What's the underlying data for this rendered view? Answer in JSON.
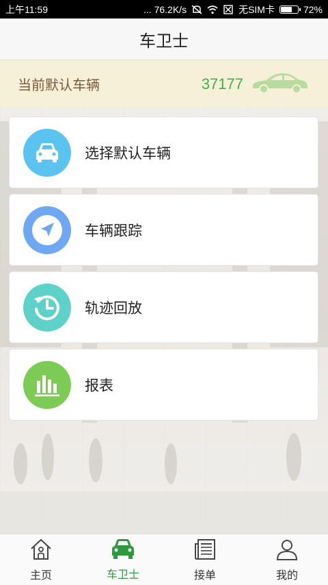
{
  "status_bar": {
    "time": "上午11:59",
    "network_speed": "... 76.2K/s",
    "sim": "无SIM卡",
    "battery": "72%",
    "battery_level": 0.72
  },
  "header": {
    "title": "车卫士"
  },
  "default_vehicle": {
    "label": "当前默认车辆",
    "plate": "37177",
    "car_color": "#b8dca0"
  },
  "menu": [
    {
      "label": "选择默认车辆",
      "icon": "car-icon",
      "color": "#5bc3ef"
    },
    {
      "label": "车辆跟踪",
      "icon": "navigation-arrow-icon",
      "color": "#6ea8f2"
    },
    {
      "label": "轨迹回放",
      "icon": "history-clock-icon",
      "color": "#5ed2c9"
    },
    {
      "label": "报表",
      "icon": "bar-chart-icon",
      "color": "#7ccb55"
    }
  ],
  "bottom_nav": {
    "active_color": "#2e9a3d",
    "items": [
      {
        "label": "主页",
        "icon": "home-icon",
        "active": false
      },
      {
        "label": "车卫士",
        "icon": "car-icon",
        "active": true
      },
      {
        "label": "接单",
        "icon": "newspaper-icon",
        "active": false
      },
      {
        "label": "我的",
        "icon": "user-icon",
        "active": false
      }
    ]
  }
}
